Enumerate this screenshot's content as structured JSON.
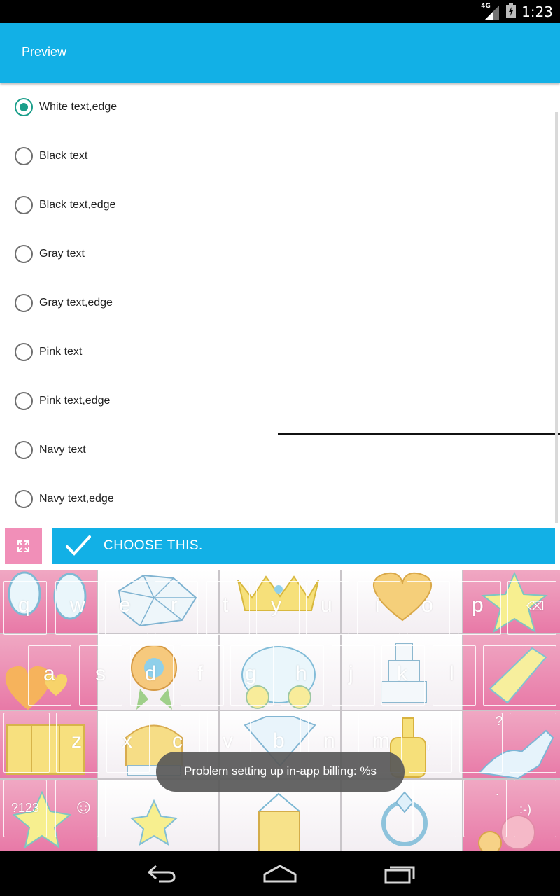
{
  "status_bar": {
    "time": "1:23",
    "network": "4G",
    "icons": [
      "signal-icon",
      "battery-icon"
    ]
  },
  "app_bar": {
    "title": "Preview"
  },
  "options": [
    {
      "label": "White text,edge",
      "checked": true
    },
    {
      "label": "Black text",
      "checked": false
    },
    {
      "label": "Black text,edge",
      "checked": false
    },
    {
      "label": "Gray text",
      "checked": false
    },
    {
      "label": "Gray text,edge",
      "checked": false
    },
    {
      "label": "Pink text",
      "checked": false
    },
    {
      "label": "Pink text,edge",
      "checked": false
    },
    {
      "label": "Navy text",
      "checked": false
    },
    {
      "label": "Navy text,edge",
      "checked": false
    }
  ],
  "actions": {
    "expand_icon": "expand-icon",
    "choose_label": "CHOOSE THIS."
  },
  "keyboard": {
    "rows": [
      [
        "q",
        "w",
        "e",
        "r",
        "t",
        "y",
        "u",
        "i",
        "o",
        "p",
        "⌫"
      ],
      [
        "a",
        "s",
        "d",
        "f",
        "g",
        "h",
        "j",
        "k",
        "l"
      ],
      [
        "z",
        "x",
        "c",
        "v",
        "b",
        "n",
        "m",
        ",",
        ".",
        "?"
      ],
      [
        "?123",
        "☺",
        "",
        "",
        "",
        "",
        ".",
        ":-)"
      ]
    ]
  },
  "toast": {
    "message": "Problem setting up in-app billing: %s"
  },
  "nav_bar": {
    "buttons": [
      "back-icon",
      "home-icon",
      "recents-icon"
    ]
  },
  "colors": {
    "accent": "#12b0e6",
    "radio_checked": "#1a9e8a",
    "pink": "#f18fb8"
  }
}
